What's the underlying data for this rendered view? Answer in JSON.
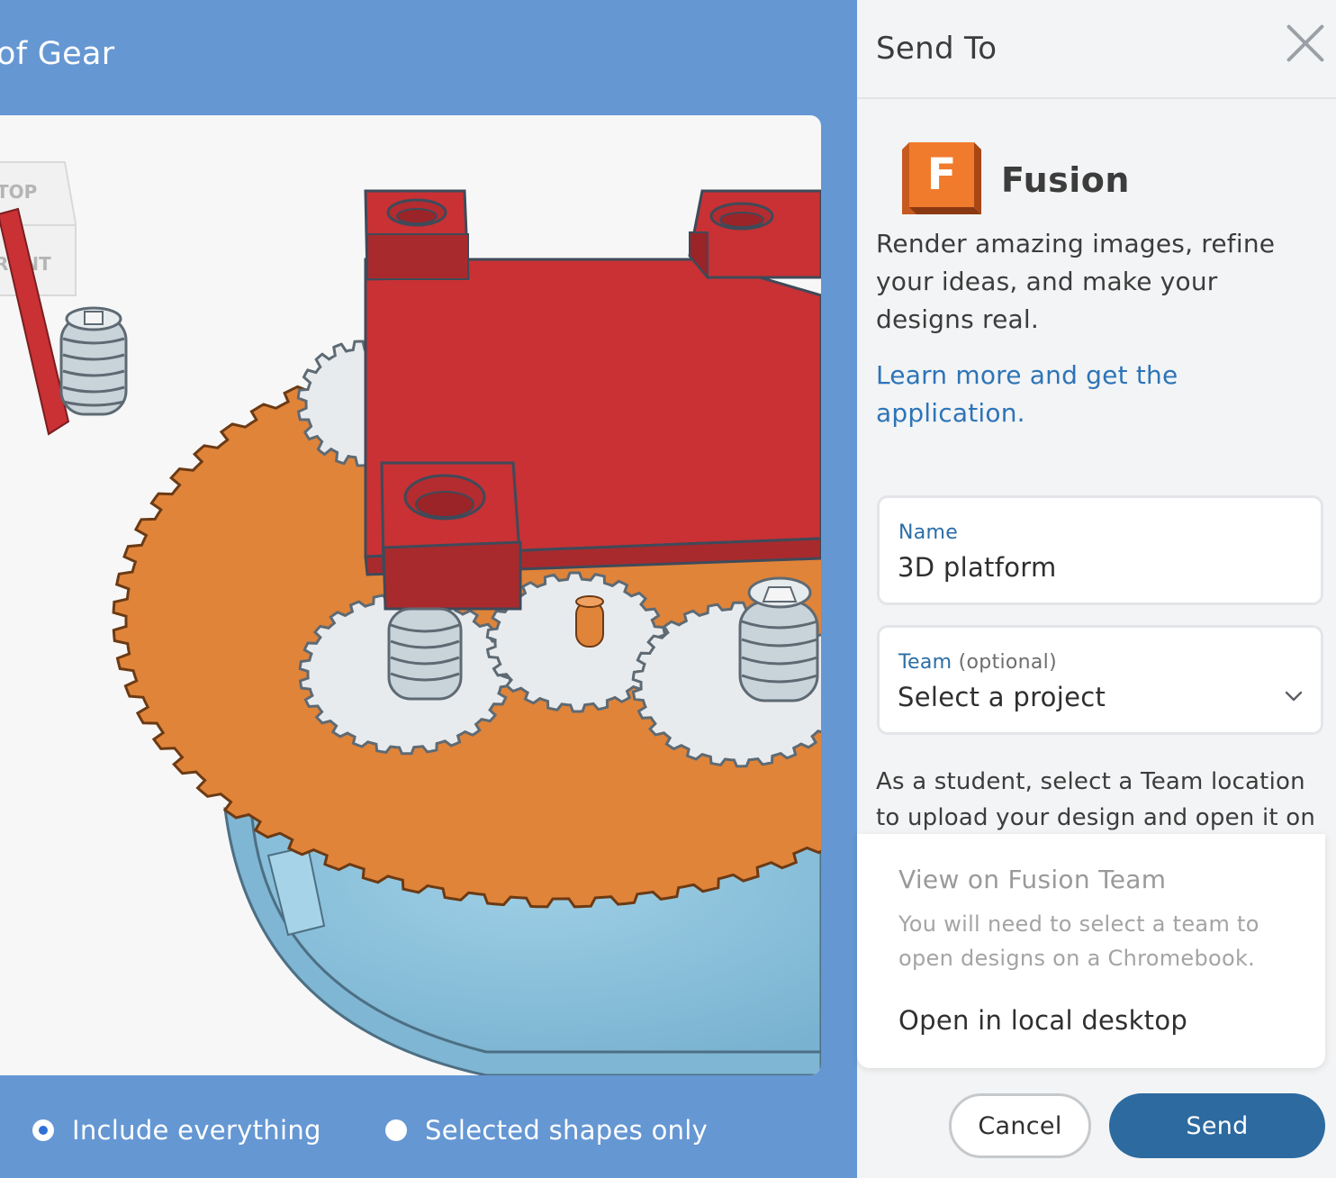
{
  "preview": {
    "title": "of Gear",
    "viewcube": {
      "top_label": "TOP",
      "front_label": "RONT"
    },
    "scope_options": [
      {
        "label": "Include everything",
        "checked": true
      },
      {
        "label": "Selected shapes only",
        "checked": false
      }
    ]
  },
  "send_to": {
    "title": "Send To",
    "close_icon": "close-icon",
    "app": {
      "logo_letter": "F",
      "name": "Fusion",
      "description": "Render amazing images, refine your ideas, and make your designs real.",
      "learn_more_link": "Learn more and get the application."
    },
    "name_field": {
      "label": "Name",
      "value": "3D platform"
    },
    "team_field": {
      "label": "Team",
      "optional_label": "(optional)",
      "selected": "Select a project",
      "icon": "chevron-down-icon"
    },
    "student_note": "As a student, select a Team location to upload your design and open it on",
    "menu": {
      "disabled_item": {
        "title": "View on Fusion Team",
        "subtitle": "You will need to select a team to open designs on a Chromebook."
      },
      "local_item": "Open in local desktop"
    },
    "cancel_label": "Cancel",
    "send_label": "Send"
  },
  "colors": {
    "preview_bg": "#6597d3",
    "panel_bg": "#f3f4f5",
    "send_button": "#2c6aa0",
    "link": "#2d74b8",
    "fusion_orange": "#e8752b",
    "gear_orange": "#e0843a",
    "platform_red": "#c93134",
    "base_blue": "#8ec3dd"
  }
}
